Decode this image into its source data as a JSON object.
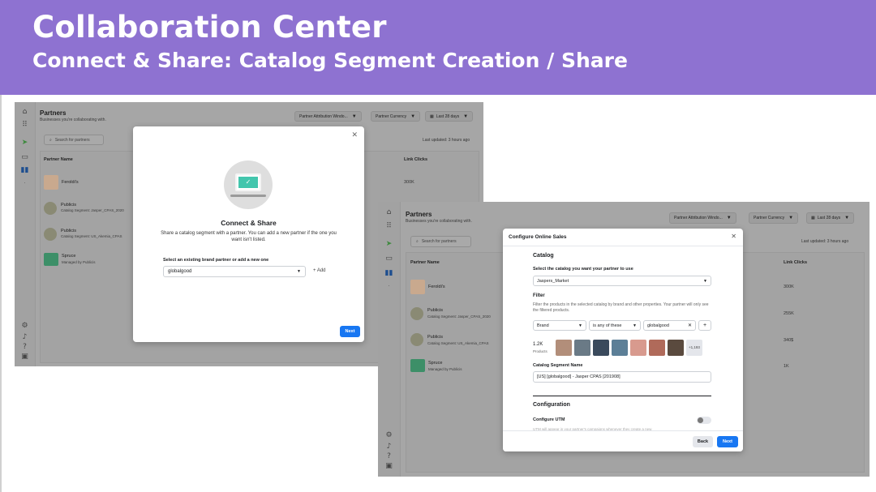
{
  "header": {
    "title": "Collaboration Center",
    "subtitle": "Connect & Share: Catalog Segment Creation / Share"
  },
  "colors": {
    "header_bg": "#8e72d1",
    "primary_button": "#1877f2",
    "teal_illustration": "#43c6ad"
  },
  "page": {
    "title": "Partners",
    "subtitle": "Businesses you're collaborating with.",
    "filters": {
      "attribution": "Partner Attribution Windo...",
      "currency": "Partner Currency",
      "date": "Last 28 days"
    },
    "search_placeholder": "Search for partners",
    "last_updated": "Last updated: 3 hours ago",
    "columns": {
      "name": "Partner Name",
      "clicks": "Link Clicks"
    },
    "rows": [
      {
        "name": "Feroldi's",
        "sub": "",
        "clicks": "300K"
      },
      {
        "name": "Publicis",
        "sub": "Catalog Segment: Jasper_CPAS_2020",
        "clicks": "255K"
      },
      {
        "name": "Publicis",
        "sub": "Catalog Segment: US_Akemia_CPAS",
        "clicks": "340$"
      },
      {
        "name": "Spruce",
        "sub": "Managed by Publicis",
        "clicks": "1K"
      }
    ]
  },
  "connect_modal": {
    "title": "Connect & Share",
    "description": "Share a catalog segment with a partner. You can add a new partner if the one you want isn't listed.",
    "select_label": "Select an existing brand partner or add a new one",
    "select_value": "globalgood",
    "add_label": "+ Add",
    "next_label": "Next"
  },
  "configure_modal": {
    "title": "Configure Online Sales",
    "catalog_heading": "Catalog",
    "catalog_label": "Select the catalog you want your partner to use",
    "catalog_value": "Jaspers_Market",
    "filter_heading": "Filter",
    "filter_desc": "Filter the products in the selected catalog by brand and other properties. Your partner will only see the filtered products.",
    "filter_field": "Brand",
    "filter_operator": "is any of these",
    "filter_value": "globalgood",
    "product_count": "1.2K",
    "products_label": "Products",
    "more_count": "+1,193",
    "segment_label": "Catalog Segment Name",
    "segment_value": "[US] [globalgood] - Jasper CPAS [201908]",
    "config_heading": "Configuration",
    "utm_label": "Configure UTM",
    "utm_desc": "UTM will appear in your partner's campaigns whenever they create a new",
    "back_label": "Back",
    "next_label": "Next"
  }
}
